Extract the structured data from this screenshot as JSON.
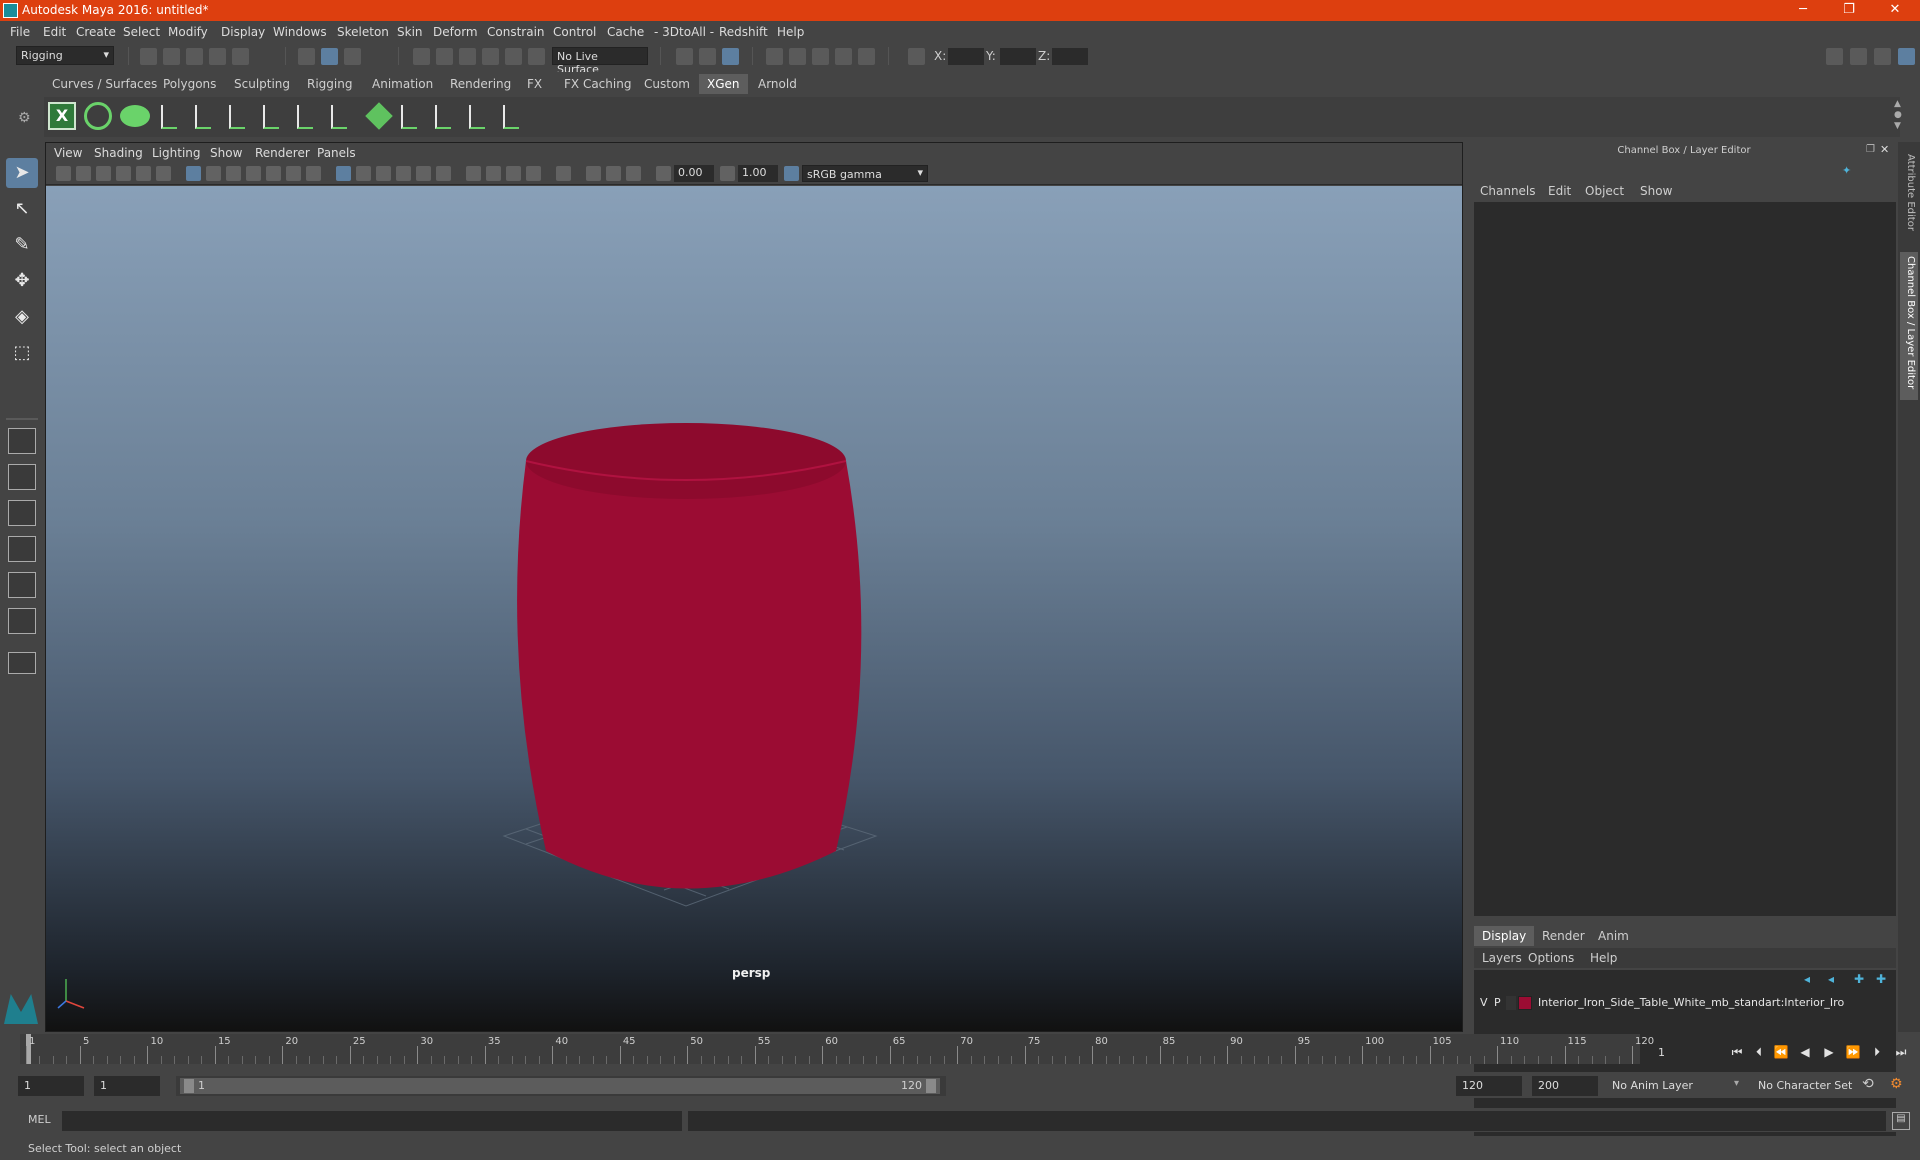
{
  "window": {
    "title": "Autodesk Maya 2016: untitled*",
    "controls": [
      "─",
      "❐",
      "✕"
    ]
  },
  "menubar": [
    "File",
    "Edit",
    "Create",
    "Select",
    "Modify",
    "Display",
    "Windows",
    "Skeleton",
    "Skin",
    "Deform",
    "Constrain",
    "Control",
    "Cache",
    "- 3DtoAll -",
    "Redshift",
    "Help"
  ],
  "statusline": {
    "menu_set": "Rigging",
    "live_surface": "No Live Surface",
    "x_label": "X:",
    "y_label": "Y:",
    "z_label": "Z:"
  },
  "shelf": {
    "tabs": [
      "Curves / Surfaces",
      "Polygons",
      "Sculpting",
      "Rigging",
      "Animation",
      "Rendering",
      "FX",
      "FX Caching",
      "Custom",
      "XGen",
      "Arnold"
    ],
    "active_tab": "XGen"
  },
  "viewport": {
    "menus": [
      "View",
      "Shading",
      "Lighting",
      "Show",
      "Renderer",
      "Panels"
    ],
    "exposure": "0.00",
    "gamma": "1.00",
    "color_space": "sRGB gamma",
    "camera": "persp",
    "wire_color": "#9b0c33"
  },
  "channel_box": {
    "title": "Channel Box / Layer Editor",
    "menus": [
      "Channels",
      "Edit",
      "Object",
      "Show"
    ]
  },
  "layer_editor": {
    "tabs": [
      "Display",
      "Render",
      "Anim"
    ],
    "active_tab": "Display",
    "menus": [
      "Layers",
      "Options",
      "Help"
    ],
    "layer": {
      "v": "V",
      "p": "P",
      "name": "Interior_Iron_Side_Table_White_mb_standart:Interior_Iro",
      "color": "#9b0c33"
    }
  },
  "side_tabs": [
    "Attribute Editor",
    "Channel Box / Layer Editor"
  ],
  "timeslider": {
    "labels": [
      "1",
      "5",
      "10",
      "15",
      "20",
      "25",
      "30",
      "35",
      "40",
      "45",
      "50",
      "55",
      "60",
      "65",
      "70",
      "75",
      "80",
      "85",
      "90",
      "95",
      "100",
      "105",
      "110",
      "115",
      "120"
    ],
    "current_frame": "1"
  },
  "range": {
    "start": "1",
    "anim_start": "1",
    "range_start": "1",
    "range_end": "120",
    "end": "120",
    "anim_end": "200",
    "anim_layer": "No Anim Layer",
    "char_set": "No Character Set"
  },
  "mel": {
    "label": "MEL"
  },
  "help_line": "Select Tool: select an object"
}
